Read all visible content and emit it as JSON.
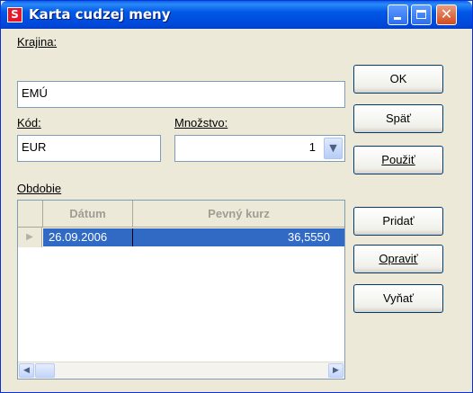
{
  "window": {
    "title": "Karta cudzej meny",
    "app_icon_glyph": "S",
    "controls": {
      "close_glyph": "✕"
    }
  },
  "form": {
    "krajina": {
      "label": "Krajina:",
      "value": "EMÚ"
    },
    "kod": {
      "label": "Kód:",
      "value": "EUR"
    },
    "mnozstvo": {
      "label": "Množstvo:",
      "value": "1",
      "dropdown_glyph": "▼"
    },
    "obdobie": {
      "label": "Obdobie"
    }
  },
  "grid": {
    "columns": [
      "Dátum",
      "Pevný kurz"
    ],
    "rows": [
      {
        "datum": "26.09.2006",
        "kurz": "36,5550"
      }
    ],
    "row_indicator": "▶",
    "scroll_left": "◀",
    "scroll_right": "▶"
  },
  "buttons": {
    "ok": "OK",
    "spat": "Späť",
    "pouzit": "Použiť",
    "pridat": "Pridať",
    "opravit": "Opraviť",
    "vynat": "Vyňať"
  },
  "colors": {
    "titlebar": "#0054e3",
    "selection": "#316ac5",
    "dialog_bg": "#ece9d8",
    "close_button": "#d44a1c"
  },
  "icons": [
    "app-logo-icon",
    "minimize-icon",
    "maximize-icon",
    "close-icon",
    "chevron-down-icon",
    "row-pointer-icon",
    "arrow-left-icon",
    "arrow-right-icon"
  ]
}
